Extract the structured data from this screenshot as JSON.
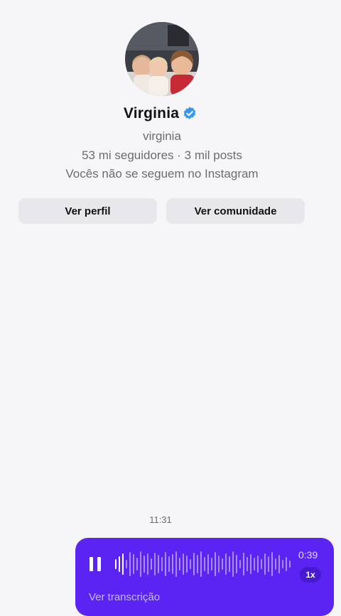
{
  "profile": {
    "name": "Virginia",
    "username": "virginia",
    "stats": "53 mi seguidores · 3 mil posts",
    "relation": "Vocês não se seguem no Instagram"
  },
  "actions": {
    "view_profile": "Ver perfil",
    "view_community": "Ver comunidade"
  },
  "chat": {
    "timestamp": "11:31"
  },
  "audio_message": {
    "duration": "0:39",
    "speed": "1x",
    "transcript_label": "Ver transcrição",
    "progress": 0.06
  },
  "colors": {
    "background": "#f6f6f9",
    "audio_bubble": "#5b24f2",
    "verified_badge": "#3897f0"
  },
  "icons": {
    "verified": "verified-badge-icon",
    "pause": "pause-icon"
  }
}
